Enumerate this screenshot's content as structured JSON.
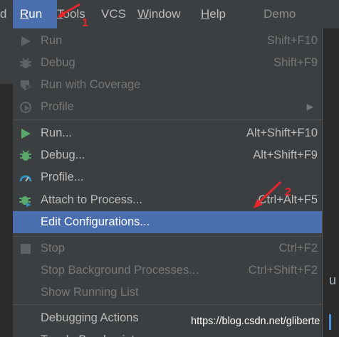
{
  "menubar": {
    "items": [
      {
        "label": "d"
      },
      {
        "label": "Run",
        "mnemonic": "R",
        "rest": "un"
      },
      {
        "label": "Tools",
        "mnemonic": "T",
        "rest": "ools"
      },
      {
        "label": "VCS"
      },
      {
        "label": "Window",
        "mnemonic": "W",
        "rest": "indow"
      },
      {
        "label": "Help",
        "mnemonic": "H",
        "rest": "elp"
      }
    ],
    "project_title": "Demo"
  },
  "run_menu": {
    "items": [
      {
        "label": "Run",
        "shortcut": "Shift+F10",
        "icon": "run-icon",
        "enabled": false
      },
      {
        "label": "Debug",
        "shortcut": "Shift+F9",
        "icon": "debug-icon",
        "enabled": false
      },
      {
        "label": "Run with Coverage",
        "shortcut": "",
        "icon": "coverage-icon",
        "enabled": false
      },
      {
        "label": "Profile",
        "shortcut": "",
        "icon": "profile-icon",
        "enabled": false,
        "submenu": true
      },
      {
        "label": "Run...",
        "shortcut": "Alt+Shift+F10",
        "icon": "run-icon",
        "enabled": true
      },
      {
        "label": "Debug...",
        "shortcut": "Alt+Shift+F9",
        "icon": "debug-icon",
        "enabled": true
      },
      {
        "label": "Profile...",
        "shortcut": "",
        "icon": "profiler-gauge-icon",
        "enabled": true
      },
      {
        "label": "Attach to Process...",
        "shortcut": "Ctrl+Alt+F5",
        "icon": "attach-process-icon",
        "enabled": true
      },
      {
        "label": "Edit Configurations...",
        "shortcut": "",
        "icon": "",
        "enabled": true,
        "selected": true
      },
      {
        "label": "Stop",
        "shortcut": "Ctrl+F2",
        "icon": "stop-icon",
        "enabled": false
      },
      {
        "label": "Stop Background Processes...",
        "shortcut": "Ctrl+Shift+F2",
        "icon": "",
        "enabled": false
      },
      {
        "label": "Show Running List",
        "shortcut": "",
        "icon": "",
        "enabled": false
      },
      {
        "label": "Debugging Actions",
        "shortcut": "",
        "icon": "",
        "enabled": true,
        "submenu": true
      },
      {
        "label": "Toggle Breakpoint",
        "shortcut": "",
        "icon": "",
        "enabled": true
      }
    ]
  },
  "annotations": {
    "step1": "1",
    "step2": "2"
  },
  "watermark": "https://blog.csdn.net/gliberte",
  "colors": {
    "menubar_bg": "#3c3f41",
    "selection": "#4b6eaf",
    "run_green": "#59a869",
    "profiler_blue": "#3592c4",
    "annotation_red": "#e8262c"
  }
}
